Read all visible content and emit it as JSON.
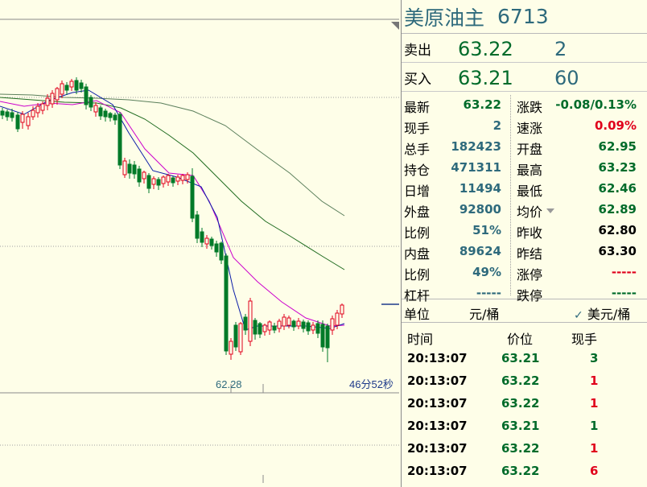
{
  "instrument": {
    "name": "美原油主",
    "code": "6713"
  },
  "quote": {
    "ask": {
      "label": "卖出",
      "price": "63.22",
      "volume": "2"
    },
    "bid": {
      "label": "买入",
      "price": "63.21",
      "volume": "60"
    }
  },
  "stats": [
    {
      "l1": "最新",
      "v1": "63.22",
      "c1": "#006b2a",
      "l2": "涨跌",
      "v2": "-0.08/0.13%",
      "c2": "#006b2a"
    },
    {
      "l1": "现手",
      "v1": "2",
      "c1": "#2e6a7c",
      "l2": "速涨",
      "v2": "0.09%",
      "c2": "#e0001b"
    },
    {
      "l1": "总手",
      "v1": "182423",
      "c1": "#2e6a7c",
      "l2": "开盘",
      "v2": "62.95",
      "c2": "#006b2a"
    },
    {
      "l1": "持仓",
      "v1": "471311",
      "c1": "#2e6a7c",
      "l2": "最高",
      "v2": "63.23",
      "c2": "#006b2a"
    },
    {
      "l1": "日增",
      "v1": "11494",
      "c1": "#2e6a7c",
      "l2": "最低",
      "v2": "62.46",
      "c2": "#006b2a"
    },
    {
      "l1": "外盘",
      "v1": "92800",
      "c1": "#2e6a7c",
      "l2": "均价",
      "v2": "62.89",
      "c2": "#006b2a"
    },
    {
      "l1": "比例",
      "v1": "51%",
      "c1": "#2e6a7c",
      "l2": "昨收",
      "v2": "62.80",
      "c2": "#000000"
    },
    {
      "l1": "内盘",
      "v1": "89624",
      "c1": "#2e6a7c",
      "l2": "昨结",
      "v2": "63.30",
      "c2": "#000000"
    },
    {
      "l1": "比例",
      "v1": "49%",
      "c1": "#2e6a7c",
      "l2": "涨停",
      "v2": "-----",
      "c2": "#e0001b"
    },
    {
      "l1": "杠杆",
      "v1": "-----",
      "c1": "#2e6a7c",
      "l2": "跌停",
      "v2": "-----",
      "c2": "#006b2a"
    }
  ],
  "units": {
    "label": "单位",
    "unit1": "元/桶",
    "check": "✓",
    "unit2": "美元/桶"
  },
  "trades_header": {
    "time": "时间",
    "price": "价位",
    "volume": "现手"
  },
  "trades": [
    {
      "time": "20:13:07",
      "price": "63.21",
      "volume": "3",
      "vcolor": "#006b2a"
    },
    {
      "time": "20:13:07",
      "price": "63.22",
      "volume": "1",
      "vcolor": "#e0001b"
    },
    {
      "time": "20:13:07",
      "price": "63.22",
      "volume": "1",
      "vcolor": "#e0001b"
    },
    {
      "time": "20:13:07",
      "price": "63.21",
      "volume": "1",
      "vcolor": "#006b2a"
    },
    {
      "time": "20:13:07",
      "price": "63.22",
      "volume": "1",
      "vcolor": "#e0001b"
    },
    {
      "time": "20:13:07",
      "price": "63.22",
      "volume": "6",
      "vcolor": "#e0001b"
    }
  ],
  "chart": {
    "low_label": "62.28",
    "countdown": "46分52秒",
    "colors": {
      "up": "#e0001b",
      "down": "#007a28",
      "ma5": "#0c1ea8",
      "ma10": "#cc00cc",
      "ma20": "#1f6b1f",
      "ma60": "#5b7f5b"
    }
  }
}
